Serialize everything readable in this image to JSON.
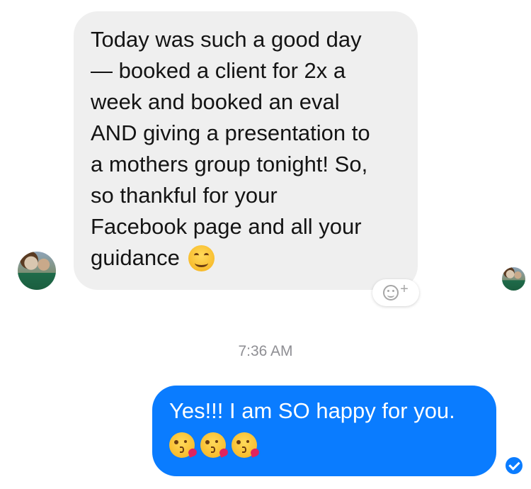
{
  "conversation": {
    "incoming": {
      "lines": [
        "Today was such a good day",
        "— booked a client for 2x a",
        "week and booked an eval",
        "AND giving a presentation to",
        "a mothers group tonight! So,",
        "so thankful for your",
        "Facebook page and all your"
      ],
      "last_line": "guidance",
      "emoji": "smiling-face-emoji",
      "sender_avatar": "contact-avatar"
    },
    "react_button": {
      "icon": "add-reaction-icon",
      "plus": "+"
    },
    "timestamp": "7:36 AM",
    "outgoing": {
      "text": "Yes!!! I am SO happy for you.",
      "emojis": [
        "kissing-face-emoji",
        "kissing-face-emoji",
        "kissing-face-emoji"
      ],
      "status": "seen-check-icon"
    }
  },
  "colors": {
    "incoming_bubble": "#efefef",
    "outgoing_bubble": "#0a7cff",
    "timestamp": "#8e8e93",
    "text_dark": "#141414"
  }
}
